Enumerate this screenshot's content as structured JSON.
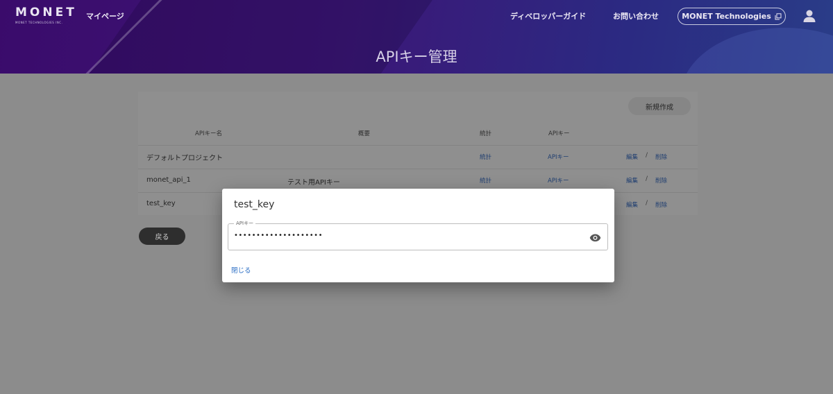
{
  "header": {
    "logo_text": "MONET",
    "logo_subtext": "MONET TECHNOLOGIES INC.",
    "nav_mypage": "マイページ",
    "nav_developer_guide": "ディベロッパーガイド",
    "nav_contact": "お問い合わせ",
    "company_button": "MONET Technologies",
    "page_title": "APIキー管理"
  },
  "toolbar": {
    "new_button": "新規作成"
  },
  "table": {
    "columns": [
      "APIキー名",
      "概要",
      "統計",
      "APIキー"
    ],
    "rows": [
      {
        "name": "デフォルトプロジェクト",
        "summary": "",
        "stats": "統計",
        "apikey": "APIキー",
        "edit": "編集",
        "separator": "/",
        "delete": "削除"
      },
      {
        "name": "monet_api_1",
        "summary": "テスト用APIキー",
        "stats": "統計",
        "apikey": "APIキー",
        "edit": "編集",
        "separator": "/",
        "delete": "削除"
      },
      {
        "name": "test_key",
        "summary": "",
        "stats": "",
        "apikey": "",
        "edit": "編集",
        "separator": "/",
        "delete": "削除"
      }
    ]
  },
  "back_button": "戻る",
  "dialog": {
    "title": "test_key",
    "field_label": "APIキー",
    "field_value": "••••••••••••••••••••",
    "close_label": "閉じる"
  },
  "colors": {
    "header_start": "#3a0b6b",
    "header_end": "#2a3d88",
    "overlay_bg": "#8c8c8c",
    "link": "#2a6dc4"
  },
  "icons": {
    "external": "external-link-icon",
    "user": "user-icon",
    "visibility": "eye-icon"
  }
}
